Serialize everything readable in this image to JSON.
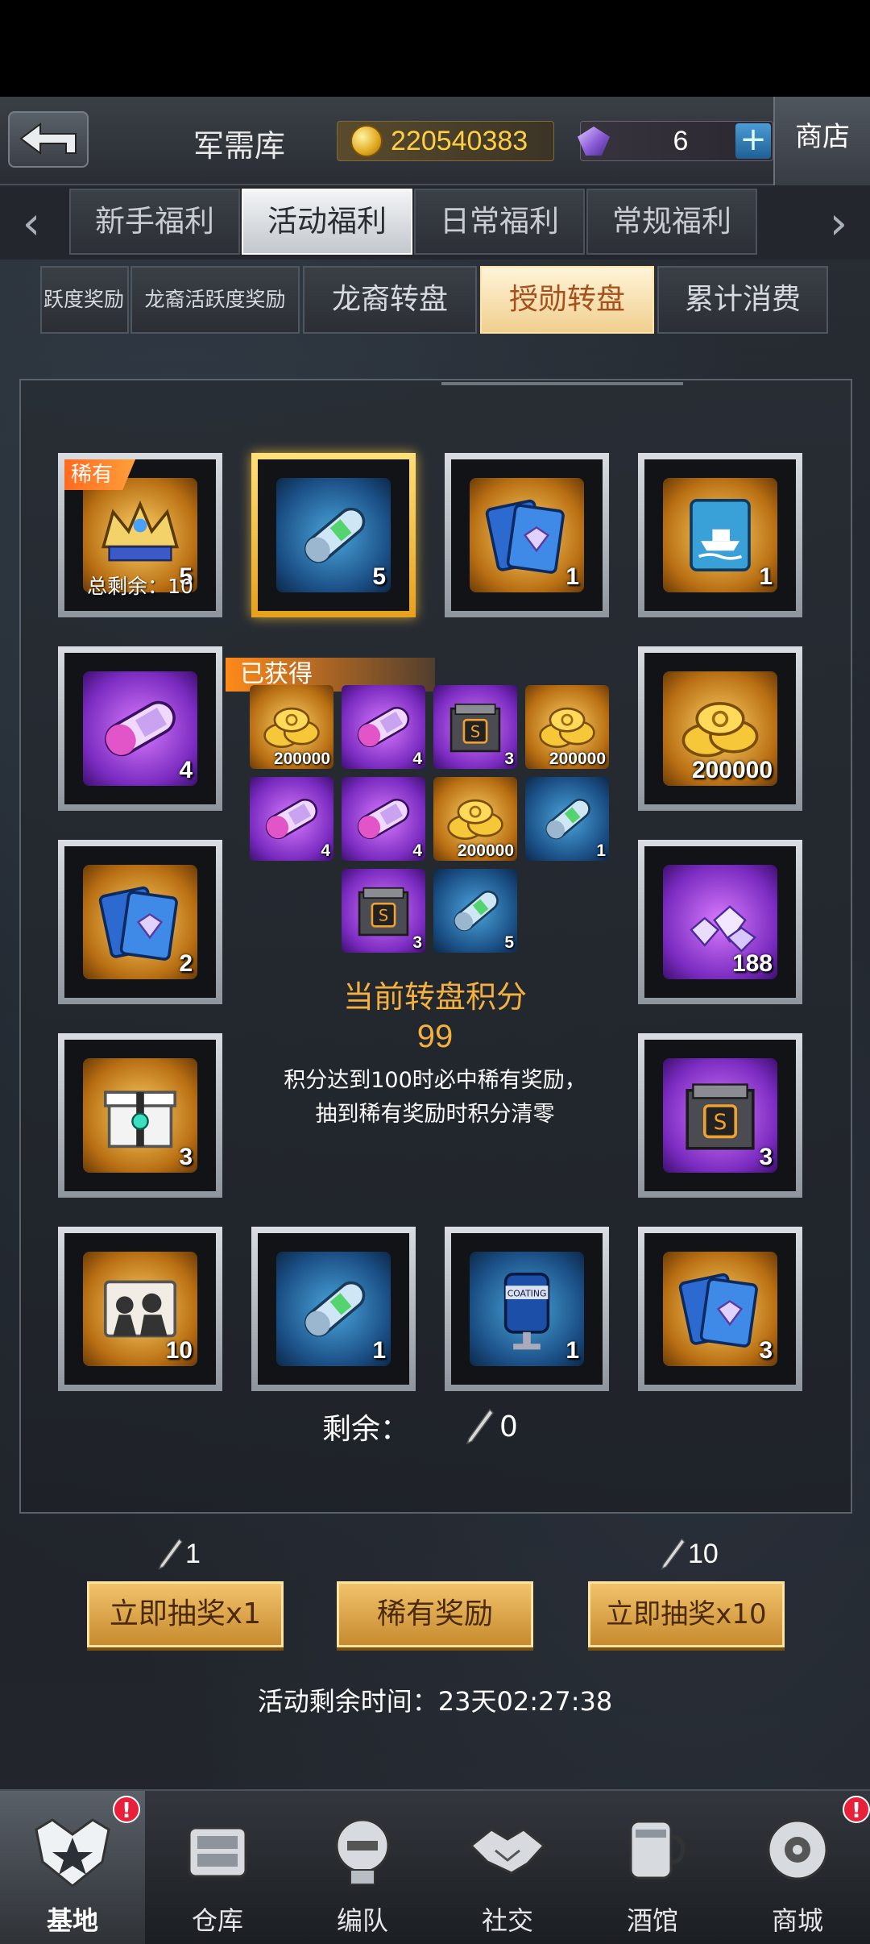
{
  "header": {
    "title": "军需库",
    "gold": "220540383",
    "gems": "6",
    "shop_label": "商店"
  },
  "main_tabs": [
    {
      "label": "新手福利",
      "active": false
    },
    {
      "label": "活动福利",
      "active": true
    },
    {
      "label": "日常福利",
      "active": false
    },
    {
      "label": "常规福利",
      "active": false
    }
  ],
  "sub_tabs": [
    {
      "label": "跃度奖励",
      "active": false
    },
    {
      "label": "龙裔活跃度奖励",
      "active": false
    },
    {
      "label": "龙裔转盘",
      "active": false
    },
    {
      "label": "授勋转盘",
      "active": true
    },
    {
      "label": "累计消费",
      "active": false
    }
  ],
  "wheel_items": [
    {
      "icon": "crown-icon",
      "count": "5",
      "bg": "gold",
      "rare_label": "稀有",
      "remain_label": "总剩余：10"
    },
    {
      "icon": "blue-capsule-icon",
      "count": "5",
      "bg": "blue",
      "selected": true
    },
    {
      "icon": "diamond-card-icon",
      "count": "1",
      "bg": "gold"
    },
    {
      "icon": "ship-card-icon",
      "count": "1",
      "bg": "gold"
    },
    {
      "icon": "purple-capsule-icon",
      "count": "4",
      "bg": "purple"
    },
    {
      "icon": "gold-coins-icon",
      "count": "200000",
      "bg": "gold"
    },
    {
      "icon": "diamond-card-icon",
      "count": "2",
      "bg": "gold"
    },
    {
      "icon": "diamond-pile-icon",
      "count": "188",
      "bg": "purple"
    },
    {
      "icon": "gift-box-icon",
      "count": "3",
      "bg": "gold"
    },
    {
      "icon": "mystery-box-icon",
      "count": "3",
      "bg": "purple"
    },
    {
      "icon": "character-card-icon",
      "count": "10",
      "bg": "gold"
    },
    {
      "icon": "blue-capsule-icon",
      "count": "1",
      "bg": "blue"
    },
    {
      "icon": "coating-canister-icon",
      "count": "1",
      "bg": "blue",
      "text": "COATING"
    },
    {
      "icon": "diamond-card-icon",
      "count": "3",
      "bg": "gold"
    }
  ],
  "obtained": {
    "banner": "已获得",
    "items": [
      {
        "icon": "gold-coins-icon",
        "count": "200000",
        "bg": "gold"
      },
      {
        "icon": "purple-capsule-icon",
        "count": "4",
        "bg": "purple"
      },
      {
        "icon": "mystery-box-icon",
        "count": "3",
        "bg": "purple"
      },
      {
        "icon": "gold-coins-icon",
        "count": "200000",
        "bg": "gold"
      },
      {
        "icon": "purple-capsule-icon",
        "count": "4",
        "bg": "purple"
      },
      {
        "icon": "purple-capsule-icon",
        "count": "4",
        "bg": "purple"
      },
      {
        "icon": "gold-coins-icon",
        "count": "200000",
        "bg": "gold"
      },
      {
        "icon": "blue-capsule-icon",
        "count": "1",
        "bg": "blue"
      },
      {
        "icon": "mystery-box-icon",
        "count": "3",
        "bg": "purple"
      },
      {
        "icon": "blue-capsule-icon",
        "count": "5",
        "bg": "blue"
      }
    ]
  },
  "score": {
    "title": "当前转盘积分",
    "value": "99",
    "note_line1": "积分达到100时必中稀有奖励，",
    "note_line2": "抽到稀有奖励时积分清零"
  },
  "remaining": {
    "label": "剩余：",
    "value": "0"
  },
  "actions": {
    "draw1_cost": "1",
    "draw1_label": "立即抽奖x1",
    "rare_label": "稀有奖励",
    "draw10_cost": "10",
    "draw10_label": "立即抽奖x10"
  },
  "event_time": "活动剩余时间：23天02:27:38",
  "bottom_nav": [
    {
      "label": "基地",
      "icon": "base-icon",
      "active": true,
      "alert": "!"
    },
    {
      "label": "仓库",
      "icon": "warehouse-icon",
      "active": false
    },
    {
      "label": "编队",
      "icon": "formation-icon",
      "active": false
    },
    {
      "label": "社交",
      "icon": "handshake-icon",
      "active": false
    },
    {
      "label": "酒馆",
      "icon": "tavern-icon",
      "active": false
    },
    {
      "label": "商城",
      "icon": "mall-icon",
      "active": false,
      "alert": "!"
    }
  ]
}
